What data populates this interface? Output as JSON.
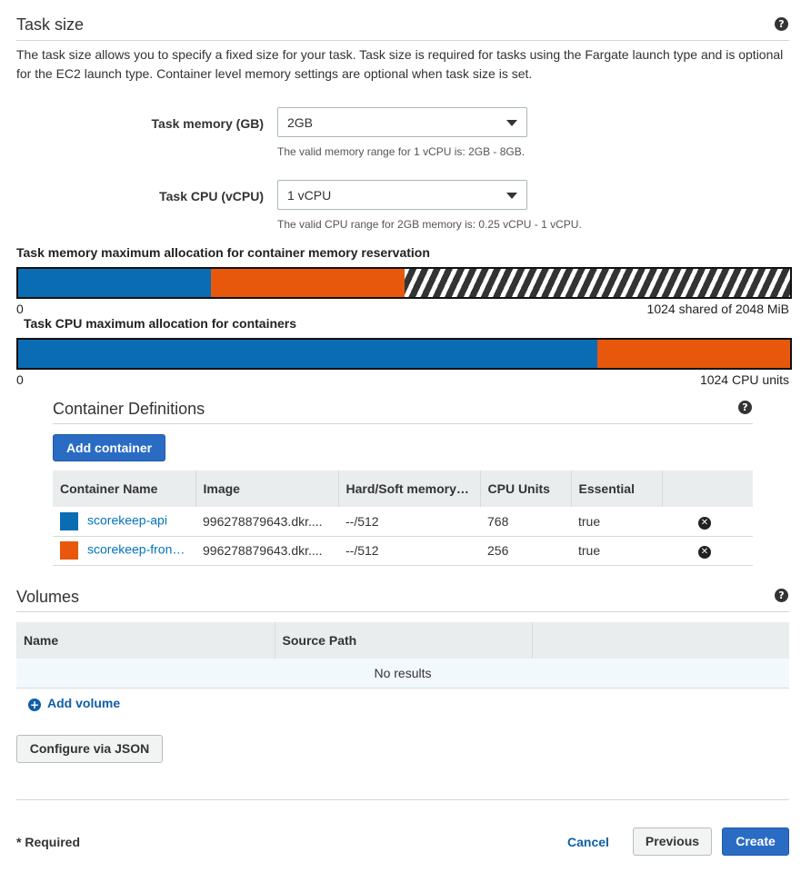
{
  "task_size": {
    "title": "Task size",
    "description": "The task size allows you to specify a fixed size for your task. Task size is required for tasks using the Fargate launch type and is optional for the EC2 launch type. Container level memory settings are optional when task size is set.",
    "memory_label": "Task memory (GB)",
    "memory_value": "2GB",
    "memory_hint": "The valid memory range for 1 vCPU is: 2GB - 8GB.",
    "cpu_label": "Task CPU (vCPU)",
    "cpu_value": "1 vCPU",
    "cpu_hint": "The valid CPU range for 2GB memory is: 0.25 vCPU - 1 vCPU."
  },
  "memory_allocation": {
    "title": "Task memory maximum allocation for container memory reservation",
    "min_label": "0",
    "max_label": "1024 shared of 2048 MiB",
    "segments": [
      {
        "name": "scorekeep-api",
        "fraction": 0.25,
        "color": "#0a6db4",
        "hatched": false
      },
      {
        "name": "scorekeep-frontend",
        "fraction": 0.25,
        "color": "#e8580c",
        "hatched": false
      },
      {
        "name": "shared",
        "fraction": 0.5,
        "color": "#333333",
        "hatched": true
      }
    ]
  },
  "cpu_allocation": {
    "title": "Task CPU maximum allocation for containers",
    "min_label": "0",
    "max_label": "1024 CPU units",
    "segments": [
      {
        "name": "scorekeep-api",
        "fraction": 0.75,
        "color": "#0a6db4"
      },
      {
        "name": "scorekeep-frontend",
        "fraction": 0.25,
        "color": "#e8580c"
      }
    ]
  },
  "container_definitions": {
    "title": "Container Definitions",
    "add_button": "Add container",
    "columns": [
      "Container Name",
      "Image",
      "Hard/Soft memory…",
      "CPU Units",
      "Essential"
    ],
    "rows": [
      {
        "name": "scorekeep-api",
        "color": "#0a6db4",
        "image": "996278879643.dkr....",
        "memory": "--/512",
        "cpu": "768",
        "essential": "true"
      },
      {
        "name": "scorekeep-fron…",
        "color": "#e8580c",
        "image": "996278879643.dkr....",
        "memory": "--/512",
        "cpu": "256",
        "essential": "true"
      }
    ]
  },
  "volumes": {
    "title": "Volumes",
    "columns": [
      "Name",
      "Source Path"
    ],
    "empty_text": "No results",
    "add_label": "Add volume"
  },
  "footer": {
    "configure_json": "Configure via JSON",
    "required": "* Required",
    "cancel": "Cancel",
    "previous": "Previous",
    "create": "Create"
  },
  "icons": {
    "help": "help-circle-icon",
    "remove": "remove-circle-icon",
    "add": "plus-circle-icon",
    "dropdown": "chevron-down-icon"
  }
}
